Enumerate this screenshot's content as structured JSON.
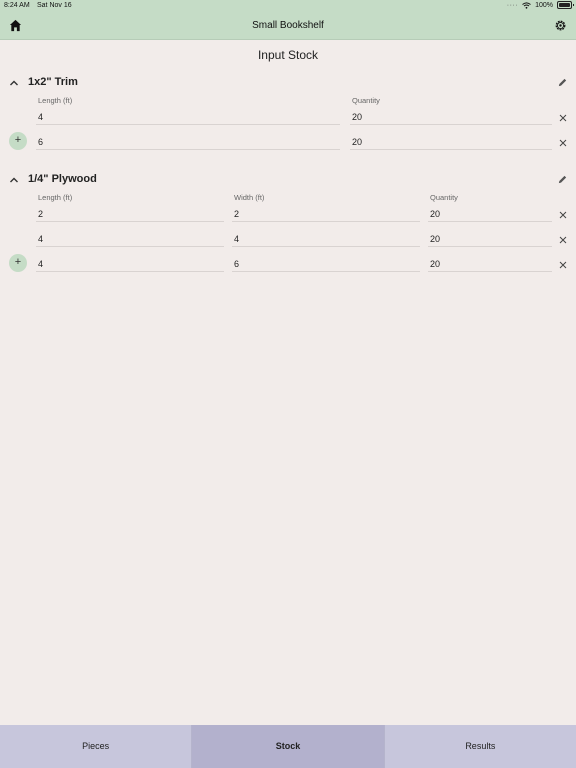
{
  "status": {
    "time": "8:24 AM",
    "date": "Sat Nov 16",
    "battery": "100%"
  },
  "nav": {
    "title": "Small Bookshelf"
  },
  "page": {
    "title": "Input Stock"
  },
  "groups": [
    {
      "name": "1x2\" Trim",
      "columns": [
        "Length (ft)",
        "Quantity"
      ],
      "rows": [
        {
          "length": "4",
          "quantity": "20"
        },
        {
          "length": "6",
          "quantity": "20"
        }
      ]
    },
    {
      "name": "1/4\" Plywood",
      "columns": [
        "Length (ft)",
        "Width (ft)",
        "Quantity"
      ],
      "rows": [
        {
          "length": "2",
          "width": "2",
          "quantity": "20"
        },
        {
          "length": "4",
          "width": "4",
          "quantity": "20"
        },
        {
          "length": "4",
          "width": "6",
          "quantity": "20"
        }
      ]
    }
  ],
  "add_label": "+",
  "tabs": [
    "Pieces",
    "Stock",
    "Results"
  ],
  "active_tab": "Stock",
  "colors": {
    "nav_bg": "#c5dcc6",
    "page_bg": "#f2ecea",
    "tab_bg": "#c7c6dc",
    "tab_active_bg": "#b3b1cd"
  },
  "icons": [
    "home-icon",
    "settings-icon",
    "chevron-up-icon",
    "pencil-icon",
    "close-icon",
    "wifi-icon",
    "battery-icon"
  ]
}
